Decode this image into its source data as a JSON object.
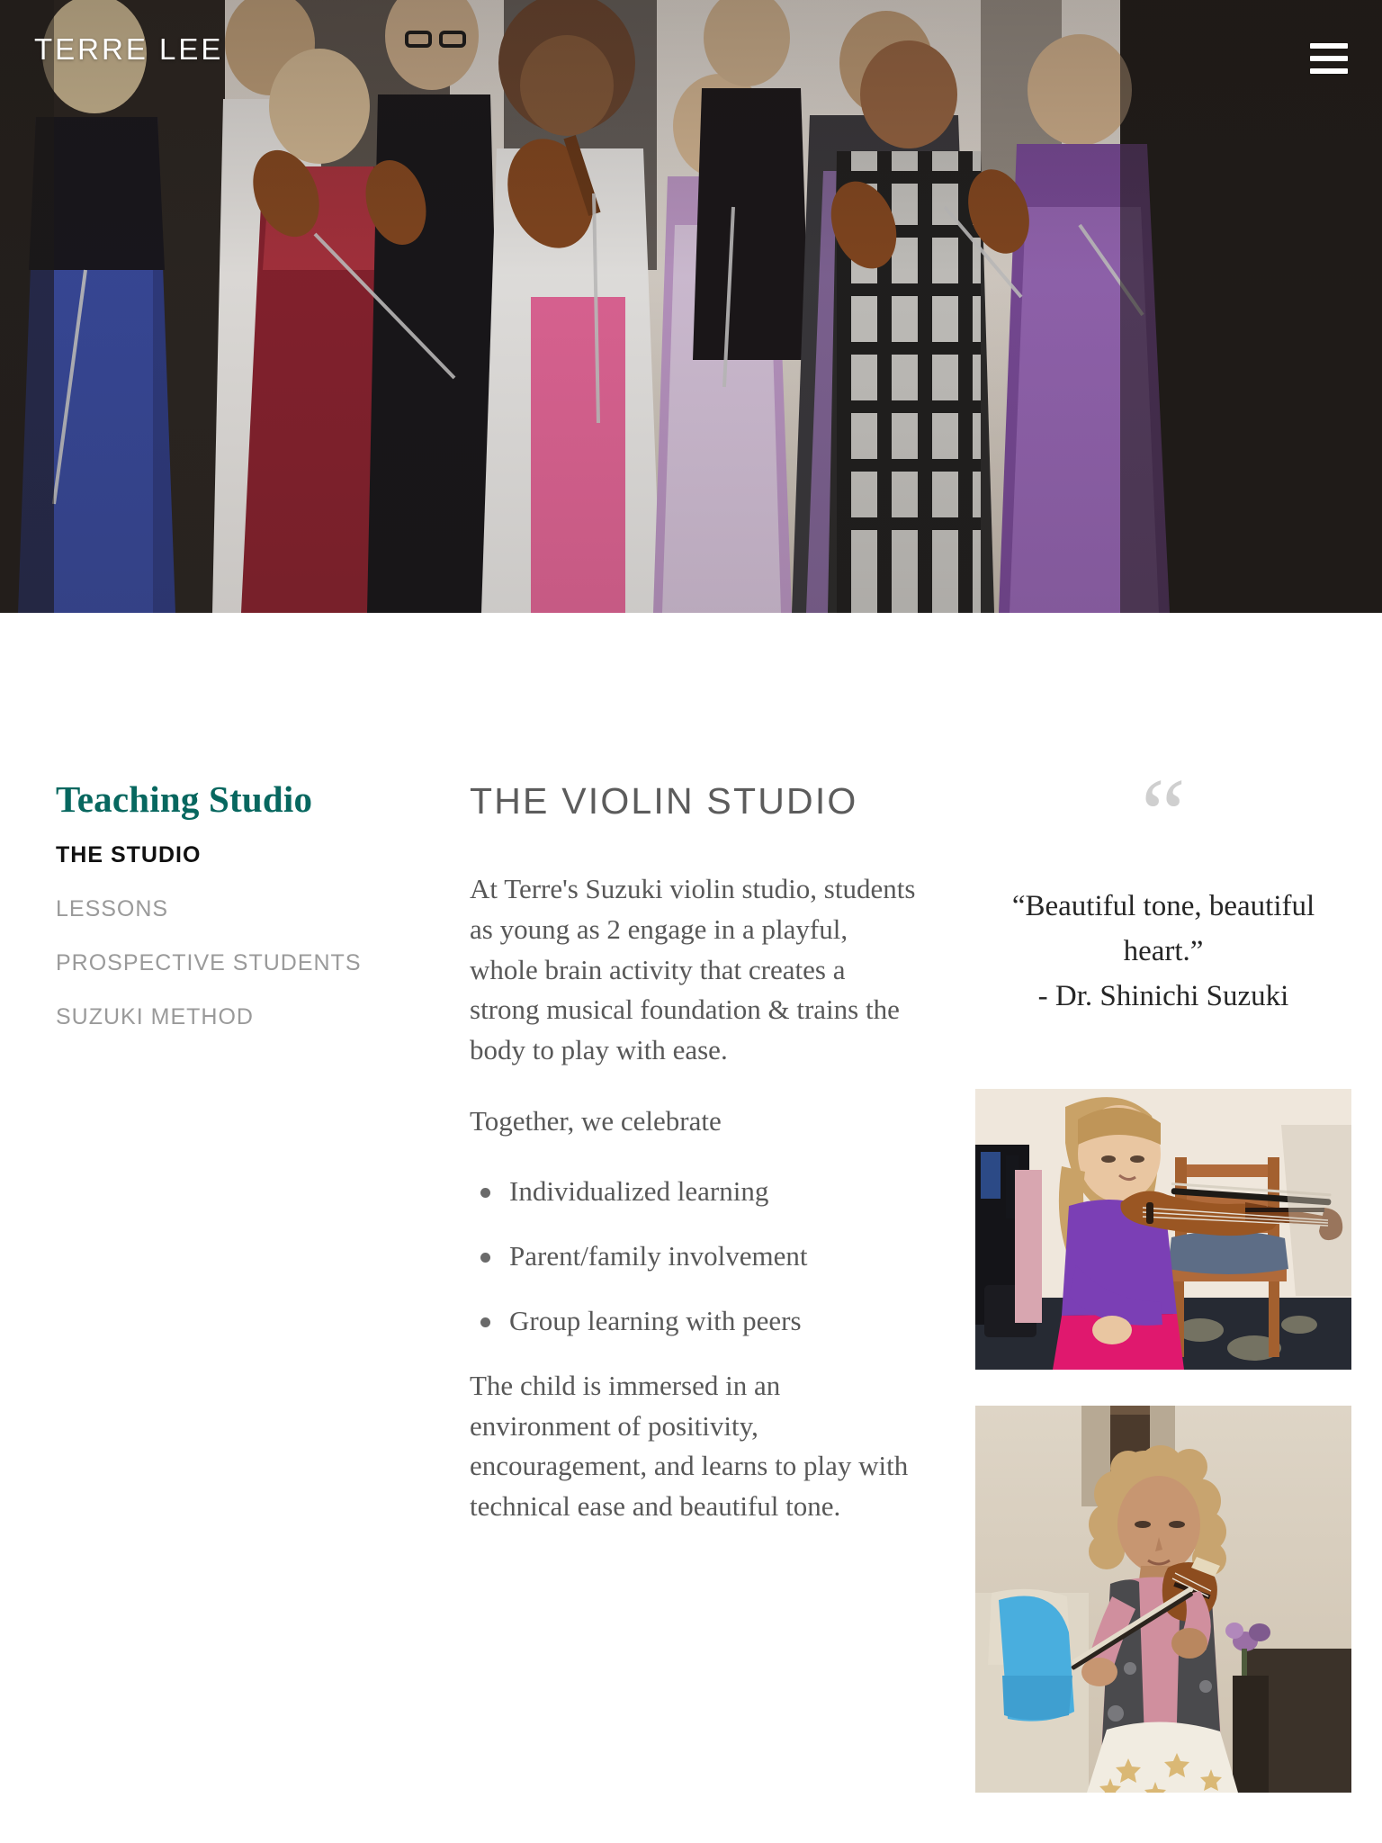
{
  "site": {
    "title": "TERRE LEE",
    "menu_icon": "hamburger-menu-icon"
  },
  "hero": {
    "alt": "Group of children holding violins at a recital",
    "overlay_color": "#1e1612"
  },
  "sidebar": {
    "heading": "Teaching Studio",
    "items": [
      {
        "label": "THE STUDIO",
        "active": true
      },
      {
        "label": "LESSONS",
        "active": false
      },
      {
        "label": "PROSPECTIVE STUDENTS",
        "active": false
      },
      {
        "label": "SUZUKI METHOD",
        "active": false
      }
    ],
    "accent_color": "#07675f"
  },
  "main": {
    "heading": "THE VIOLIN STUDIO",
    "paragraph_1": "At Terre's Suzuki violin studio, students as young as 2 engage in a playful, whole brain activity that creates a strong musical foundation & trains the body to play with ease.",
    "list_intro": "Together, we celebrate",
    "list_items": [
      "Individualized learning",
      "Parent/family involvement",
      "Group learning with peers"
    ],
    "paragraph_2": "The child is immersed in an environment of positivity, encouragement, and learns to play with technical ease and beautiful tone."
  },
  "quote": {
    "mark": "“",
    "text": "“Beautiful tone, beautiful heart.”",
    "attribution": "- Dr. Shinichi Suzuki",
    "mark_color": "#cfcfcf"
  },
  "photos": [
    {
      "name": "photo-girl-purple-shirt-violin",
      "alt": "Young girl in purple shirt holding a violin in rest position"
    },
    {
      "name": "photo-girl-curly-hair-performing",
      "alt": "Young girl with curly hair performing on violin"
    }
  ]
}
